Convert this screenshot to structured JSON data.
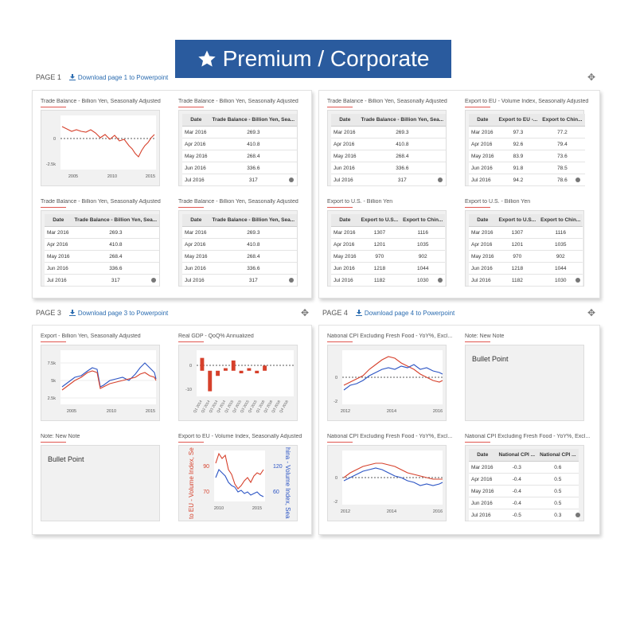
{
  "banner": {
    "label": "Premium / Corporate",
    "color": "#2a5b9e"
  },
  "pages": [
    {
      "label": "PAGE 1",
      "download": "Download page 1 to Powerpoint"
    },
    {
      "label": "PAGE 3",
      "download": "Download page 3 to Powerpoint"
    },
    {
      "label": "PAGE 4",
      "download": "Download page 4 to Powerpoint"
    }
  ],
  "titles": {
    "tb": "Trade Balance - Billion Yen, Seasonally Adjusted",
    "eu_vol": "Export to EU - Volume Index, Seasonally Adjusted",
    "us": "Export to U.S. - Billion Yen",
    "exp": "Export - Billion Yen, Seasonally Adjusted",
    "gdp": "Real GDP - QoQ% Annualized",
    "note": "Note: New Note",
    "cpi": "National CPI Excluding Fresh Food - YoY%, Excl...",
    "cpi_title": "National CPI Excluding Fresh Food - YoY%, Excl..."
  },
  "note_text": "Bullet Point",
  "tables": {
    "tb": {
      "headers": [
        "Date",
        "Trade Balance - Billion Yen, Sea..."
      ],
      "rows": [
        [
          "Mar 2016",
          "269.3"
        ],
        [
          "Apr 2016",
          "410.8"
        ],
        [
          "May 2016",
          "268.4"
        ],
        [
          "Jun 2016",
          "336.6"
        ],
        [
          "Jul 2016",
          "317"
        ]
      ]
    },
    "eu": {
      "headers": [
        "Date",
        "Export to EU -...",
        "Export to Chin..."
      ],
      "rows": [
        [
          "Mar 2016",
          "97.3",
          "77.2"
        ],
        [
          "Apr 2016",
          "92.6",
          "79.4"
        ],
        [
          "May 2016",
          "83.9",
          "73.6"
        ],
        [
          "Jun 2016",
          "91.8",
          "78.5"
        ],
        [
          "Jul 2016",
          "94.2",
          "78.6"
        ]
      ]
    },
    "us": {
      "headers": [
        "Date",
        "Export to U.S...",
        "Export to Chin..."
      ],
      "rows": [
        [
          "Mar 2016",
          "1307",
          "1116"
        ],
        [
          "Apr 2016",
          "1201",
          "1035"
        ],
        [
          "May 2016",
          "970",
          "902"
        ],
        [
          "Jun 2016",
          "1218",
          "1044"
        ],
        [
          "Jul 2016",
          "1182",
          "1030"
        ]
      ]
    },
    "cpi": {
      "headers": [
        "Date",
        "National CPI ...",
        "National CPI ..."
      ],
      "rows": [
        [
          "Mar 2016",
          "-0.3",
          "0.6"
        ],
        [
          "Apr 2016",
          "-0.4",
          "0.5"
        ],
        [
          "May 2016",
          "-0.4",
          "0.5"
        ],
        [
          "Jun 2016",
          "-0.4",
          "0.5"
        ],
        [
          "Jul 2016",
          "-0.5",
          "0.3"
        ]
      ]
    }
  },
  "chart_data": [
    {
      "type": "line",
      "title": "Trade Balance - Billion Yen, Seasonally Adjusted",
      "x_ticks": [
        "2005",
        "2010",
        "2015"
      ],
      "y_ticks": [
        "0",
        "-2.5k"
      ],
      "series": [
        {
          "color": "#d6402b"
        }
      ]
    },
    {
      "type": "line",
      "title": "Export - Billion Yen, Seasonally Adjusted",
      "x_ticks": [
        "2005",
        "2010",
        "2015"
      ],
      "y_ticks": [
        "7.5k",
        "5k",
        "2.5k"
      ],
      "series": [
        {
          "color": "#d6402b"
        },
        {
          "color": "#2b54c4"
        }
      ]
    },
    {
      "type": "bar",
      "title": "Real GDP - QoQ% Annualized",
      "y_ticks": [
        "0",
        "-10"
      ],
      "categories": [
        "Q1 2014",
        "Q2 2014",
        "Q3 2014",
        "Q4 2014",
        "Q1 2015",
        "Q2 2015",
        "Q3 2015",
        "Q4 2015",
        "Q1 2016",
        "Q2 2016",
        "Q3 2016",
        "Q4 2016"
      ],
      "values": [
        5,
        -8,
        -2,
        1,
        4,
        -1,
        1,
        -1,
        2,
        0,
        0,
        0
      ],
      "ylim": [
        -10,
        8
      ]
    },
    {
      "type": "line",
      "title": "Export to EU - Volume Index, Seasonally Adjusted",
      "x_ticks": [
        "2010",
        "2015"
      ],
      "y_left_ticks": [
        "90",
        "70"
      ],
      "y_right_ticks": [
        "120",
        "60"
      ],
      "ylabel_left": "to EU - Volume Index, Se",
      "ylabel_right": "hina - Volume Index, Sea",
      "series": [
        {
          "color": "#d6402b"
        },
        {
          "color": "#2b54c4"
        }
      ]
    },
    {
      "type": "line",
      "title": "National CPI Excluding Fresh Food - YoY%, Excl...",
      "x_ticks": [
        "2012",
        "2014",
        "2016"
      ],
      "y_ticks": [
        "0",
        "-2"
      ],
      "series": [
        {
          "color": "#d6402b"
        },
        {
          "color": "#2b54c4"
        }
      ]
    }
  ]
}
